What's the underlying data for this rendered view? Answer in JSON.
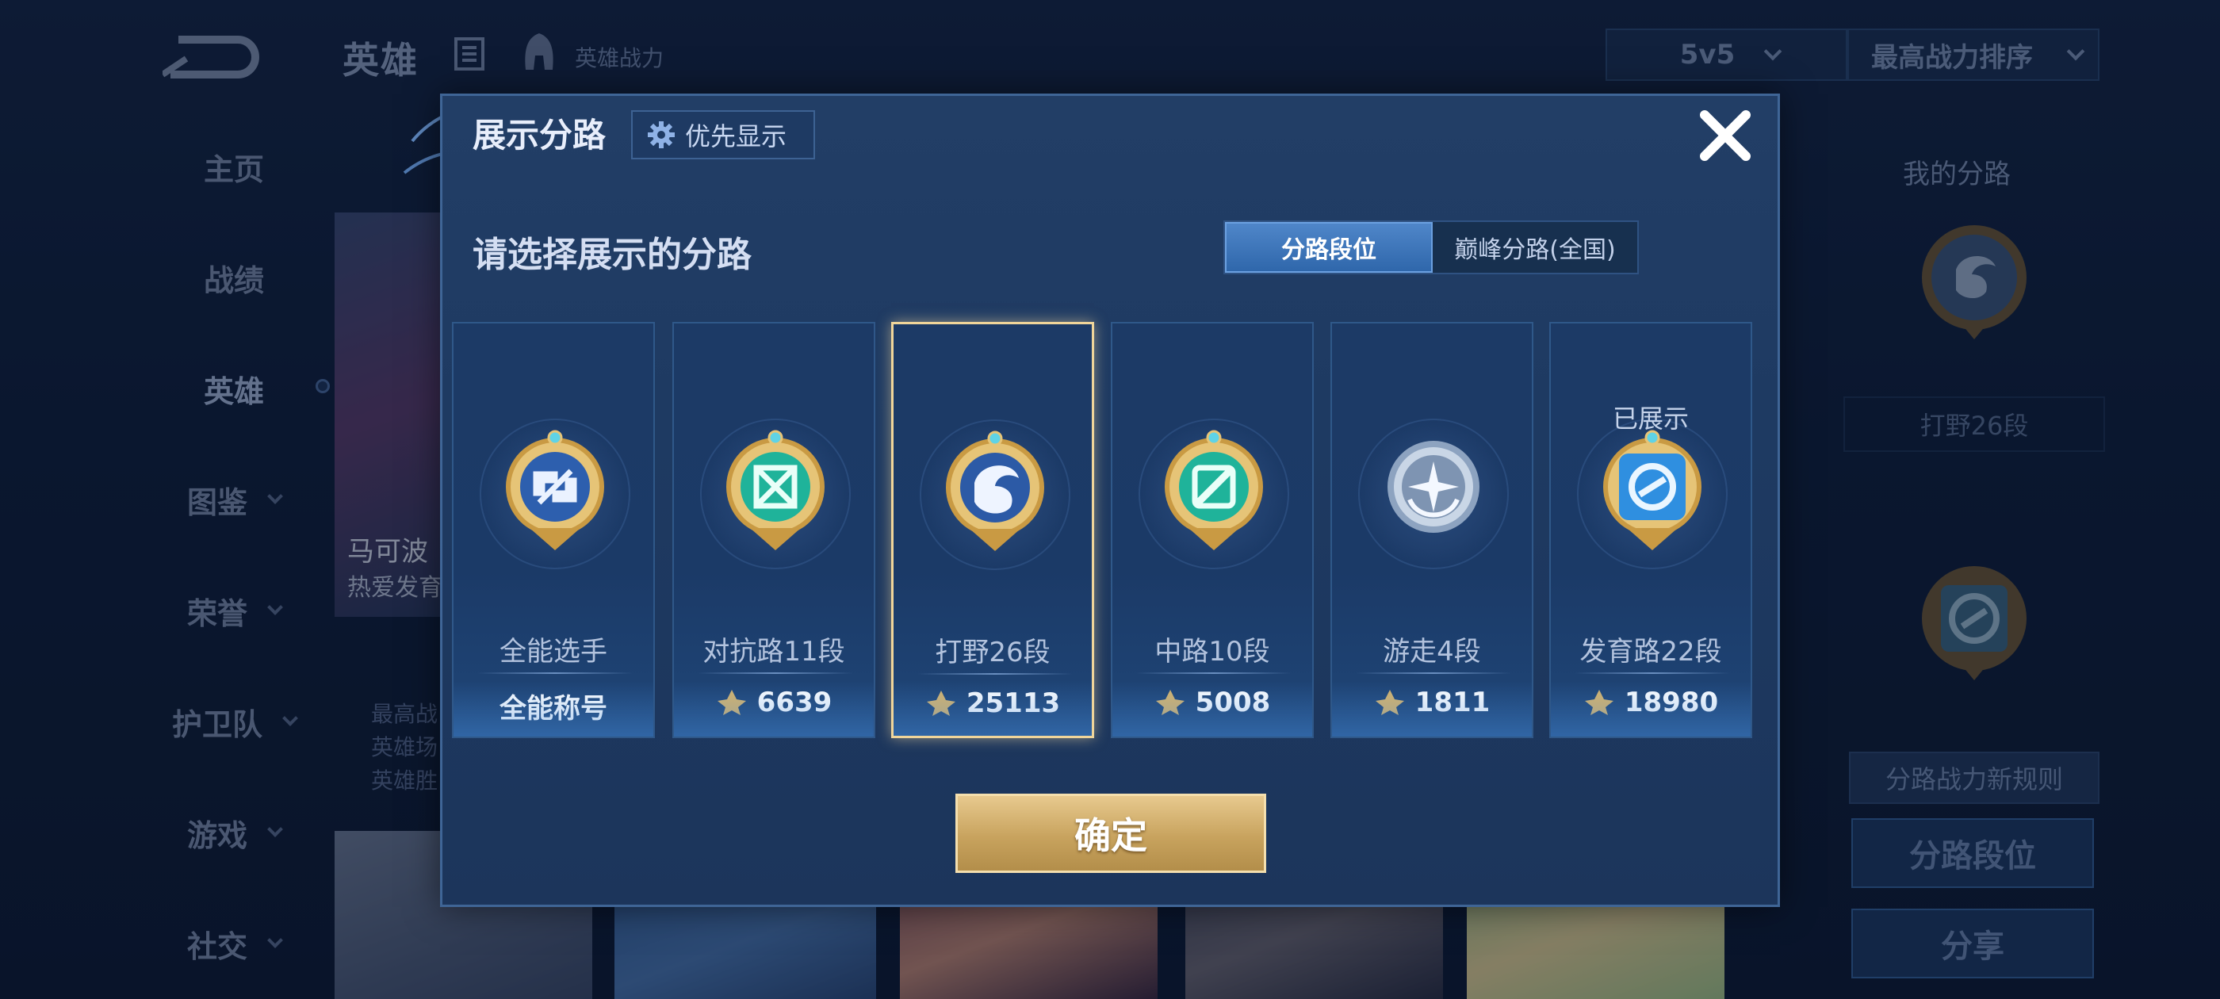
{
  "screen": {
    "title": "英雄",
    "subtitle": "英雄战力",
    "mode_select": "5v5",
    "sort_select": "最高战力排序"
  },
  "sidebar": {
    "items": [
      {
        "label": "主页",
        "chevron": false
      },
      {
        "label": "战绩",
        "chevron": false
      },
      {
        "label": "英雄",
        "chevron": false,
        "active": true
      },
      {
        "label": "图鉴",
        "chevron": true
      },
      {
        "label": "荣誉",
        "chevron": true
      },
      {
        "label": "护卫队",
        "chevron": true
      },
      {
        "label": "游戏",
        "chevron": true
      },
      {
        "label": "社交",
        "chevron": true
      }
    ]
  },
  "hero_card": {
    "name": "马可波",
    "desc": "热爱发育",
    "stats": [
      "最高战",
      "英雄场",
      "英雄胜"
    ]
  },
  "right_panel": {
    "title": "我的分路",
    "lane": "打野26段",
    "rule_button": "分路战力新规则",
    "lane_button": "分路段位",
    "share_button": "分享"
  },
  "modal": {
    "title": "展示分路",
    "priority_button": "优先显示",
    "prompt": "请选择展示的分路",
    "tabs": [
      "分路段位",
      "巅峰分路(全国)"
    ],
    "confirm": "确定",
    "cards": [
      {
        "lane": "全能选手",
        "value": "全能称号",
        "icon": "all-round-badge-icon",
        "power_icon": false,
        "shown": ""
      },
      {
        "lane": "对抗路11段",
        "value": "6639",
        "icon": "clash-lane-badge-icon",
        "power_icon": true,
        "shown": ""
      },
      {
        "lane": "打野26段",
        "value": "25113",
        "icon": "jungle-badge-icon",
        "power_icon": true,
        "shown": "",
        "selected": true
      },
      {
        "lane": "中路10段",
        "value": "5008",
        "icon": "mid-lane-badge-icon",
        "power_icon": true,
        "shown": ""
      },
      {
        "lane": "游走4段",
        "value": "1811",
        "icon": "roam-badge-icon",
        "power_icon": true,
        "shown": ""
      },
      {
        "lane": "发育路22段",
        "value": "18980",
        "icon": "farm-lane-badge-icon",
        "power_icon": true,
        "shown": "已展示"
      }
    ]
  },
  "colors": {
    "accent_gold": "#e7c98e",
    "selected_border": "#f0d59a",
    "tab_active": "#4f86c9",
    "modal_bg": "#223e66"
  }
}
